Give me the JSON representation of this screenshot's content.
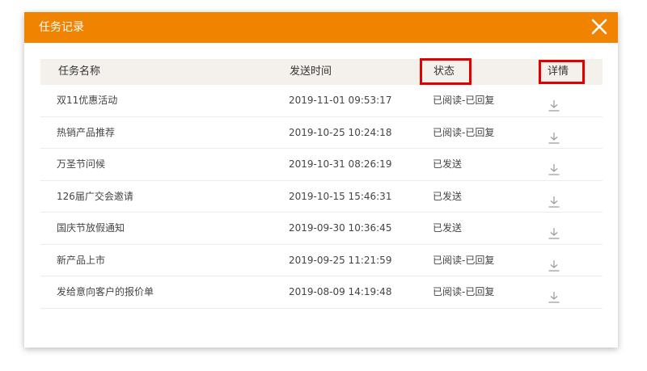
{
  "dialog": {
    "title": "任务记录",
    "close_icon": "close-icon",
    "accent_color": "#f08300"
  },
  "table": {
    "headers": {
      "name": "任务名称",
      "time": "发送时间",
      "status": "状态",
      "detail": "详情"
    },
    "highlight_color": "#e00000",
    "rows": [
      {
        "name": "双11优惠活动",
        "time": "2019-11-01 09:53:17",
        "status": "已阅读-已回复",
        "detail_icon": "download-icon"
      },
      {
        "name": "热销产品推荐",
        "time": "2019-10-25 10:24:18",
        "status": "已阅读-已回复",
        "detail_icon": "download-icon"
      },
      {
        "name": "万圣节问候",
        "time": "2019-10-31 08:26:19",
        "status": "已发送",
        "detail_icon": "download-icon"
      },
      {
        "name": "126届广交会邀请",
        "time": "2019-10-15 15:46:31",
        "status": "已发送",
        "detail_icon": "download-icon"
      },
      {
        "name": "国庆节放假通知",
        "time": "2019-09-30 10:36:45",
        "status": "已发送",
        "detail_icon": "download-icon"
      },
      {
        "name": "新产品上市",
        "time": "2019-09-25 11:21:59",
        "status": "已阅读-已回复",
        "detail_icon": "download-icon"
      },
      {
        "name": "发给意向客户的报价单",
        "time": "2019-08-09 14:19:48",
        "status": "已阅读-已回复",
        "detail_icon": "download-icon"
      }
    ]
  }
}
